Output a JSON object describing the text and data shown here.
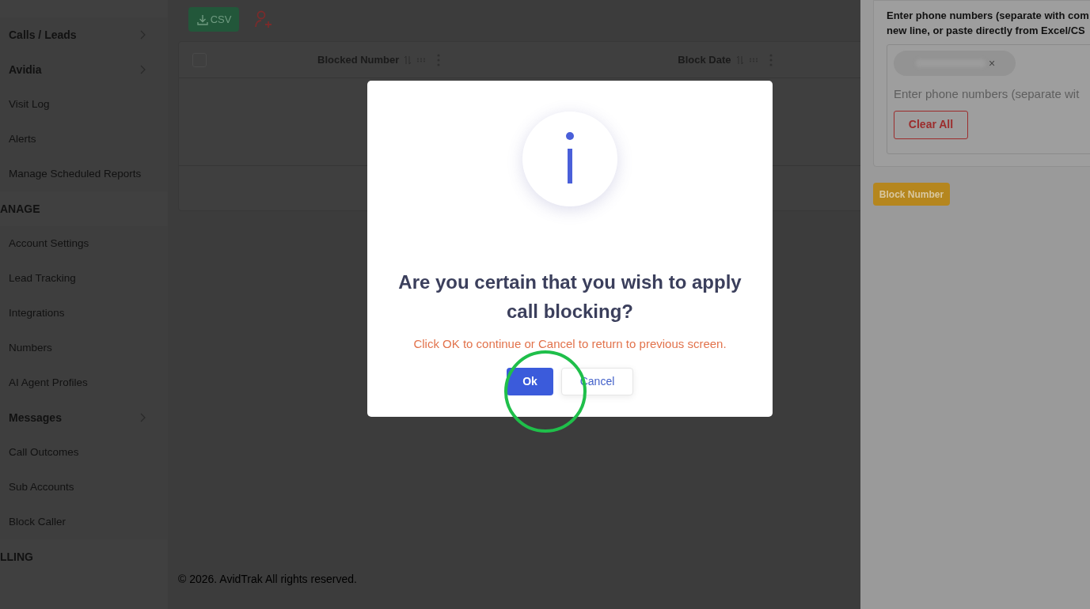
{
  "sidebar": {
    "groups": [
      {
        "items": [
          {
            "label": "Calls / Leads",
            "kind": "submenu"
          },
          {
            "label": "Avidia",
            "kind": "submenu"
          },
          {
            "label": "Visit Log",
            "kind": "link"
          },
          {
            "label": "Alerts",
            "kind": "link"
          },
          {
            "label": "Manage Scheduled Reports",
            "kind": "link"
          }
        ]
      },
      {
        "heading": "ANAGE",
        "items": [
          {
            "label": "Account Settings",
            "kind": "link"
          },
          {
            "label": "Lead Tracking",
            "kind": "link"
          },
          {
            "label": "Integrations",
            "kind": "link"
          },
          {
            "label": "Numbers",
            "kind": "link"
          },
          {
            "label": "AI Agent Profiles",
            "kind": "link"
          },
          {
            "label": "Messages",
            "kind": "submenu"
          },
          {
            "label": "Call Outcomes",
            "kind": "link"
          },
          {
            "label": "Sub Accounts",
            "kind": "link"
          },
          {
            "label": "Block Caller",
            "kind": "link"
          }
        ]
      },
      {
        "heading": "LLING"
      }
    ]
  },
  "toolbar": {
    "csv_button": "CSV"
  },
  "table": {
    "select_all_checked": false,
    "columns": [
      "Blocked Number",
      "Block Date"
    ]
  },
  "footer": "© 2026. AvidTrak All rights reserved.",
  "drawer": {
    "instructions": [
      "Enter phone numbers (separate with com",
      "new line, or paste directly from Excel/CS"
    ],
    "chip_remove": "×",
    "placeholder": "Enter phone numbers (separate wit",
    "clear_button": "Clear All",
    "submit_button": "Block Number"
  },
  "dialog": {
    "title": "Are you certain that you wish to apply call blocking?",
    "message": "Click OK to continue or Cancel to return to previous screen.",
    "buttons": [
      {
        "label": "Ok",
        "kind": "primary"
      },
      {
        "label": "Cancel",
        "kind": "secondary"
      }
    ]
  }
}
